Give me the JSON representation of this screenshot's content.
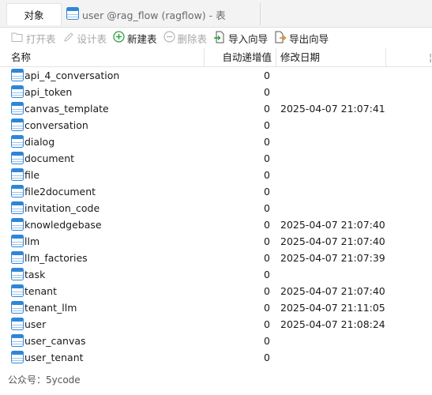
{
  "tabs": {
    "objects_label": "对象",
    "table_tab_label": "user @rag_flow (ragflow) - 表"
  },
  "toolbar": {
    "open_table": "打开表",
    "design_table": "设计表",
    "new_table": "新建表",
    "delete_table": "删除表",
    "import_wizard": "导入向导",
    "export_wizard": "导出向导"
  },
  "columns": {
    "name": "名称",
    "auto_increment": "自动递增值",
    "modified_date": "修改日期"
  },
  "rows": [
    {
      "name": "api_4_conversation",
      "auto": "0",
      "date": ""
    },
    {
      "name": "api_token",
      "auto": "0",
      "date": ""
    },
    {
      "name": "canvas_template",
      "auto": "0",
      "date": "2025-04-07 21:07:41"
    },
    {
      "name": "conversation",
      "auto": "0",
      "date": ""
    },
    {
      "name": "dialog",
      "auto": "0",
      "date": ""
    },
    {
      "name": "document",
      "auto": "0",
      "date": ""
    },
    {
      "name": "file",
      "auto": "0",
      "date": ""
    },
    {
      "name": "file2document",
      "auto": "0",
      "date": ""
    },
    {
      "name": "invitation_code",
      "auto": "0",
      "date": ""
    },
    {
      "name": "knowledgebase",
      "auto": "0",
      "date": "2025-04-07 21:07:40"
    },
    {
      "name": "llm",
      "auto": "0",
      "date": "2025-04-07 21:07:40"
    },
    {
      "name": "llm_factories",
      "auto": "0",
      "date": "2025-04-07 21:07:39"
    },
    {
      "name": "task",
      "auto": "0",
      "date": ""
    },
    {
      "name": "tenant",
      "auto": "0",
      "date": "2025-04-07 21:07:40"
    },
    {
      "name": "tenant_llm",
      "auto": "0",
      "date": "2025-04-07 21:11:05"
    },
    {
      "name": "user",
      "auto": "0",
      "date": "2025-04-07 21:08:24"
    },
    {
      "name": "user_canvas",
      "auto": "0",
      "date": ""
    },
    {
      "name": "user_tenant",
      "auto": "0",
      "date": ""
    }
  ],
  "footer": {
    "watermark": "公众号：5ycode"
  },
  "icons": {
    "table": "table-icon",
    "open": "open-table-icon",
    "design": "design-table-icon",
    "add": "add-icon",
    "delete": "delete-icon",
    "import": "import-icon",
    "export": "export-icon"
  },
  "colors": {
    "table_icon_blue": "#2f86d6",
    "add_green": "#2e9e3e"
  }
}
